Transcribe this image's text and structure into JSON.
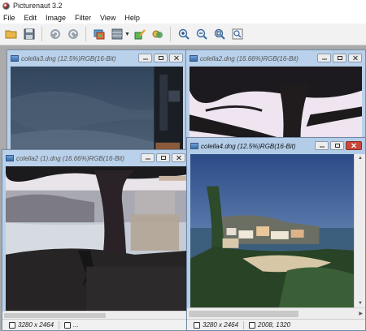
{
  "app": {
    "title": "Picturenaut 3.2"
  },
  "menu": [
    "File",
    "Edit",
    "Image",
    "Filter",
    "View",
    "Help"
  ],
  "toolbar": {
    "icons": [
      "open-folder-icon",
      "save-icon",
      "undo-icon",
      "redo-icon",
      "layers-icon",
      "grid-icon",
      "edit-icon",
      "adjust-icon",
      "zoom-in-icon",
      "zoom-out-icon",
      "zoom-fit-icon",
      "zoom-actual-icon"
    ]
  },
  "windows": {
    "w1": {
      "title": "colella3.dng (12.5%)RGB(16-Bit)"
    },
    "w2": {
      "title": "colella2.dng (16.66%)RGB(16-Bit)"
    },
    "w3": {
      "title": "colella2 (1).dng (16.66%)RGB(16-Bit)",
      "resolution": "3280 x 2464",
      "coords": "..."
    },
    "w4": {
      "title": "colella4.dng (12.5%)RGB(16-Bit)",
      "resolution": "3280 x 2464",
      "coords": "2008, 1320"
    }
  },
  "colors": {
    "win_frame": "#b9d1ea",
    "close_button": "#c7463a"
  }
}
